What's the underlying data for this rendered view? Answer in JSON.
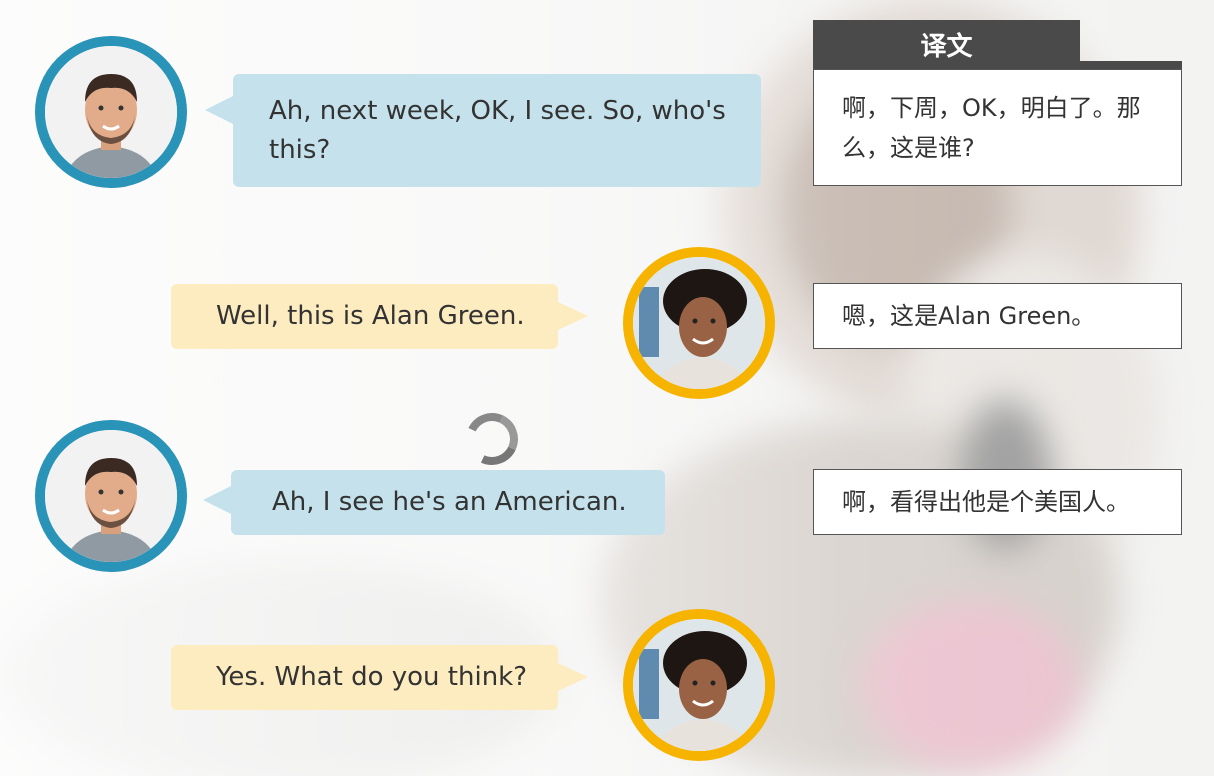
{
  "translation_header": "译文",
  "dialogue": [
    {
      "speaker": "man",
      "text": "Ah, next week, OK, I see. So, who's this?",
      "translation": "啊，下周，OK，明白了。那么，这是谁?"
    },
    {
      "speaker": "woman",
      "text": "Well, this is Alan Green.",
      "translation": "嗯，这是Alan Green。"
    },
    {
      "speaker": "man",
      "text": "Ah, I see he's an American.",
      "translation": "啊，看得出他是个美国人。"
    },
    {
      "speaker": "woman",
      "text": "Yes. What do you think?",
      "translation": ""
    }
  ],
  "colors": {
    "man_accent": "#2a93b8",
    "man_bubble": "#c5e2ec",
    "woman_accent": "#f6b400",
    "woman_bubble": "#fdecc0",
    "header_bg": "#4a4a4a"
  },
  "icons": {
    "man_avatar": "man-avatar-icon",
    "woman_avatar": "woman-avatar-icon",
    "loading": "loading-spinner-icon"
  }
}
